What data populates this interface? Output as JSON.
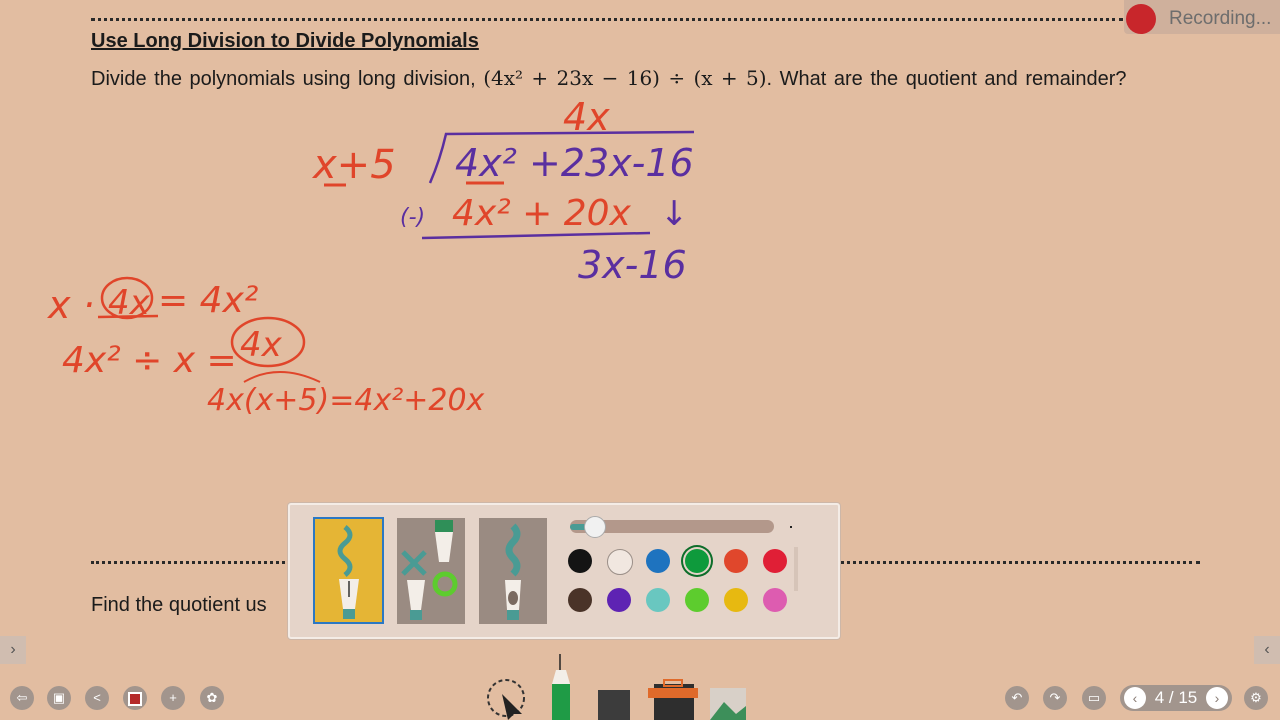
{
  "document": {
    "title": "Use Long Division to Divide Polynomials",
    "question_part1": "Divide the polynomials using long division, ",
    "question_math": "(4x² + 23x − 16) ÷ (x + 5)",
    "question_part2": ". What are the quotient and remainder?",
    "next_prompt": "Find the quotient us"
  },
  "handwriting": {
    "quotient": "4x",
    "divisor": "x+5",
    "dividend": "4x² +23x-16",
    "subtract_sign": "(-)",
    "product": "4x² + 20x",
    "bring_down_arrow": "↓",
    "remainder_line": "3x-16",
    "side_note_1_a": "x ·",
    "side_note_1_b": "4x",
    "side_note_1_c": "= 4x²",
    "side_note_2_a": "4x² ÷ x =",
    "side_note_2_b": "4x",
    "side_note_3": "4x(x+5)=4x²+20x"
  },
  "recording": {
    "label": "Recording..."
  },
  "pen_panel": {
    "tools": [
      {
        "name": "pen",
        "icon": "pen-icon",
        "selected": true
      },
      {
        "name": "shape-pen",
        "icon": "shape-pen-icon",
        "selected": false
      },
      {
        "name": "brush",
        "icon": "brush-icon",
        "selected": false
      }
    ],
    "stroke_size_level": 0.12,
    "colors_row1": [
      "#141414",
      "#f1e7e0",
      "#1e73bf",
      "#0e9a3c",
      "#e0472c",
      "#e01f36"
    ],
    "colors_row2": [
      "#4a3328",
      "#5e23b3",
      "#69c7c0",
      "#5dcc2e",
      "#e7b911",
      "#dd5cb0"
    ],
    "selected_color": "#0e9a3c"
  },
  "toolbar": {
    "left_icons": [
      "exit-icon",
      "save-icon",
      "share-icon",
      "stop-record-icon",
      "add-user-icon",
      "more-icon"
    ],
    "center_tools": [
      "select-icon",
      "pen-tool-icon",
      "eraser-icon",
      "toolbox-icon",
      "gallery-icon"
    ],
    "right_icons": [
      "undo-icon",
      "redo-icon",
      "screen-icon"
    ],
    "page_count": "4 / 15",
    "settings_icon": "settings-icon"
  },
  "colors": {
    "background": "#e2bda1",
    "ink_red": "#e0452a",
    "ink_purple": "#5a2fa0"
  }
}
